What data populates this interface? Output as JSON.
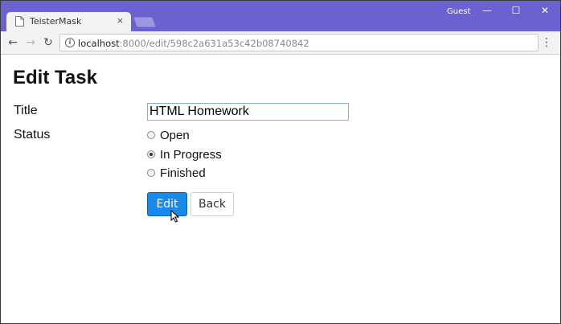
{
  "browser": {
    "tab_title": "TeisterMask",
    "tab_close": "×",
    "profile_label": "Guest",
    "window_controls": {
      "minimize": "—",
      "maximize": "☐",
      "close": "✕"
    },
    "nav": {
      "back": "←",
      "forward": "→",
      "reload": "↻"
    },
    "url_host": "localhost",
    "url_path": ":8000/edit/598c2a631a53c42b08740842",
    "info_icon": "i",
    "menu_icon": "⋮"
  },
  "page": {
    "title": "Edit Task",
    "title_label": "Title",
    "title_value": "HTML Homework",
    "status_label": "Status",
    "status_options": [
      {
        "label": "Open",
        "checked": false
      },
      {
        "label": "In Progress",
        "checked": true
      },
      {
        "label": "Finished",
        "checked": false
      }
    ],
    "edit_button": "Edit",
    "back_button": "Back"
  },
  "colors": {
    "titlebar": "#6a62d1",
    "primary_button": "#1a8ae8"
  }
}
